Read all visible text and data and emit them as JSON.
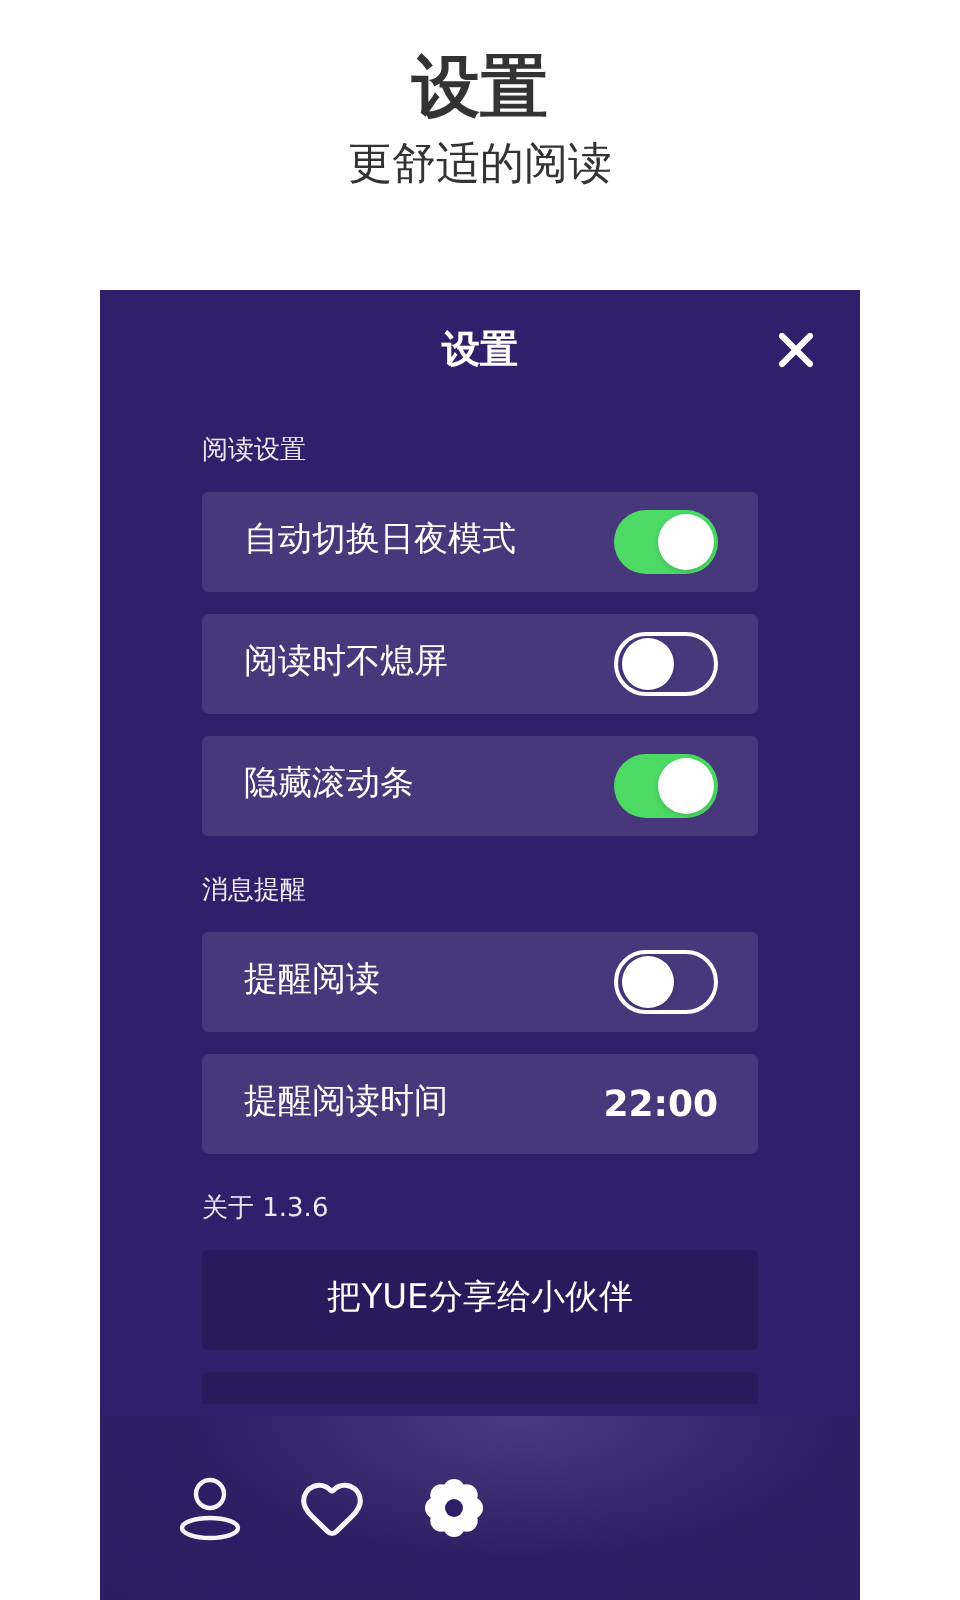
{
  "header": {
    "title": "设置",
    "subtitle": "更舒适的阅读"
  },
  "panel": {
    "title": "设置",
    "sections": [
      {
        "label": "阅读设置",
        "items": [
          {
            "kind": "toggle",
            "label": "自动切换日夜模式",
            "on": true
          },
          {
            "kind": "toggle",
            "label": "阅读时不熄屏",
            "on": false
          },
          {
            "kind": "toggle",
            "label": "隐藏滚动条",
            "on": true
          }
        ]
      },
      {
        "label": "消息提醒",
        "items": [
          {
            "kind": "toggle",
            "label": "提醒阅读",
            "on": false
          },
          {
            "kind": "value",
            "label": "提醒阅读时间",
            "value": "22:00"
          }
        ]
      },
      {
        "label": "关于 1.3.6",
        "items": [
          {
            "kind": "button",
            "label": "把YUE分享给小伙伴"
          },
          {
            "kind": "covered_button"
          }
        ]
      }
    ]
  },
  "nav": [
    {
      "kind": "user",
      "selected": false
    },
    {
      "kind": "heart",
      "selected": false
    },
    {
      "kind": "gear",
      "selected": true
    }
  ]
}
